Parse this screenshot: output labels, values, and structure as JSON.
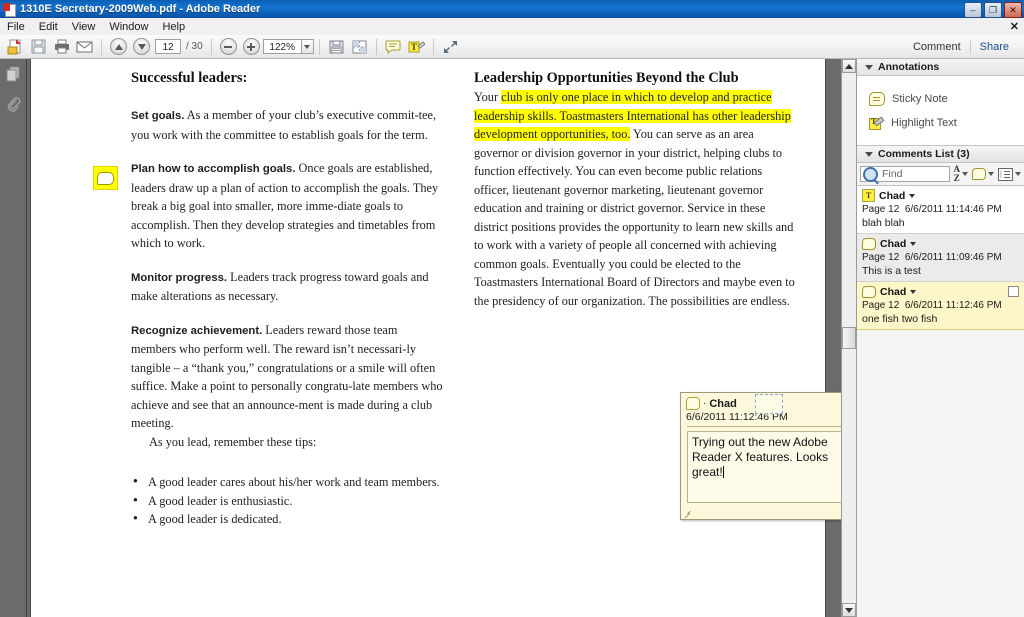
{
  "window": {
    "title": "1310E Secretary-2009Web.pdf - Adobe Reader",
    "app_icon": "pdf-document-icon",
    "minimize": "–",
    "maximize": "❐",
    "close": "✕",
    "menubar_close": "✕"
  },
  "menubar": {
    "items": [
      {
        "label": "File"
      },
      {
        "label": "Edit"
      },
      {
        "label": "View"
      },
      {
        "label": "Window"
      },
      {
        "label": "Help"
      }
    ]
  },
  "toolbar": {
    "buttons": [
      {
        "name": "open-file-icon"
      },
      {
        "name": "save-icon"
      },
      {
        "name": "print-icon"
      },
      {
        "name": "email-icon"
      }
    ],
    "page_prev_icon": "arrow-up-icon",
    "page_next_icon": "arrow-down-icon",
    "page_number": "12",
    "page_total": "/ 30",
    "zoom_out_icon": "minus-icon",
    "zoom_in_icon": "plus-icon",
    "zoom_value": "122%",
    "zoom_dropdown_icon": "chevron-down-icon",
    "snapshot_icon": "snapshot-icon",
    "page-display-icon": "page-display-icon",
    "sticky_note_icon": "sticky-note-icon",
    "highlight_icon": "highlight-text-icon",
    "fullscreen_icon": "fullscreen-icon",
    "comment_label": "Comment",
    "share_label": "Share"
  },
  "navrail": {
    "page_thumbnails_icon": "page-thumbnails-icon",
    "attachments_icon": "paperclip-icon"
  },
  "document": {
    "left_column": {
      "heading": "Successful leaders:",
      "paragraphs": [
        {
          "lead": "Set goals.",
          "text": " As a member of your club’s executive commit-tee, you work with the committee to establish goals for the term."
        },
        {
          "lead": "Plan how to accomplish goals.",
          "text": " Once goals are established, leaders draw up a plan of action to accomplish the goals. They break a big goal into smaller, more imme-diate goals to accomplish. Then they develop strategies and timetables from which to work."
        },
        {
          "lead": "Monitor progress.",
          "text": " Leaders track progress toward goals and make alterations as necessary."
        },
        {
          "lead": "Recognize achievement.",
          "text": " Leaders reward those team members who perform well. The reward isn’t necessari-ly tangible – a “thank you,” congratulations or a smile will often suffice. Make a point to personally congratu-late members who achieve and see that an announce-ment is made during a club meeting."
        }
      ],
      "tips_intro": "As you lead, remember these tips:",
      "bullets": [
        "A good leader cares about his/her work and team members.",
        "A good leader is enthusiastic.",
        "A good leader is dedicated."
      ]
    },
    "right_column": {
      "heading": "Leadership Opportunities Beyond the Club",
      "text_before_highlight": "Your ",
      "highlighted_text": "club is only one place in which to develop and practice leadership skills. Toastmasters International has other leadership development opportunities, too.",
      "text_after_highlight": " You can serve as an area governor or division governor in your district, helping clubs to function effectively. You can even become public relations officer, lieutenant governor marketing, lieutenant governor education and training or district governor. Service in these district positions provides the opportunity to learn new skills and to work with a variety of people all concerned with achieving common goals. Eventually you could be elected to the Toastmasters International Board of Directors and maybe even to the presidency of our organization. The possibilities are endless."
    },
    "note_marker_icon": "sticky-note-marker-icon"
  },
  "popup_note": {
    "icon": "sticky-note-icon",
    "author_prefix": "·",
    "author": "Chad",
    "minimize_icon": "minimize-icon",
    "date": "6/6/2011 11:12:46 PM",
    "body": "Trying out the new Adobe Reader X features. Looks great!"
  },
  "right_panel": {
    "annotations": {
      "title": "Annotations",
      "collapse_icon": "triangle-down-icon",
      "tools": [
        {
          "label": "Sticky Note",
          "icon": "sticky-note-icon"
        },
        {
          "label": "Highlight Text",
          "icon": "highlight-text-icon"
        }
      ]
    },
    "comments_list": {
      "title": "Comments List (3)",
      "collapse_icon": "triangle-down-icon",
      "find_placeholder": "Find",
      "find_value": "",
      "sort_icon": "sort-az-icon",
      "filter_icon": "comment-filter-icon",
      "options_icon": "options-list-icon",
      "items": [
        {
          "icon": "highlight-text-icon",
          "author": "Chad",
          "page": "Page 12",
          "date": "6/6/2011 11:14:46 PM",
          "text": "blah blah",
          "state": "white"
        },
        {
          "icon": "sticky-note-icon",
          "author": "Chad",
          "page": "Page 12",
          "date": "6/6/2011 11:09:46 PM",
          "text": "This is a test",
          "state": "alt"
        },
        {
          "icon": "sticky-note-icon",
          "author": "Chad",
          "page": "Page 12",
          "date": "6/6/2011 11:12:46 PM",
          "text": "one fish two fish",
          "state": "sel"
        }
      ]
    }
  },
  "scrollbar": {
    "up_icon": "scroll-up-arrow",
    "down_icon": "scroll-down-arrow"
  }
}
